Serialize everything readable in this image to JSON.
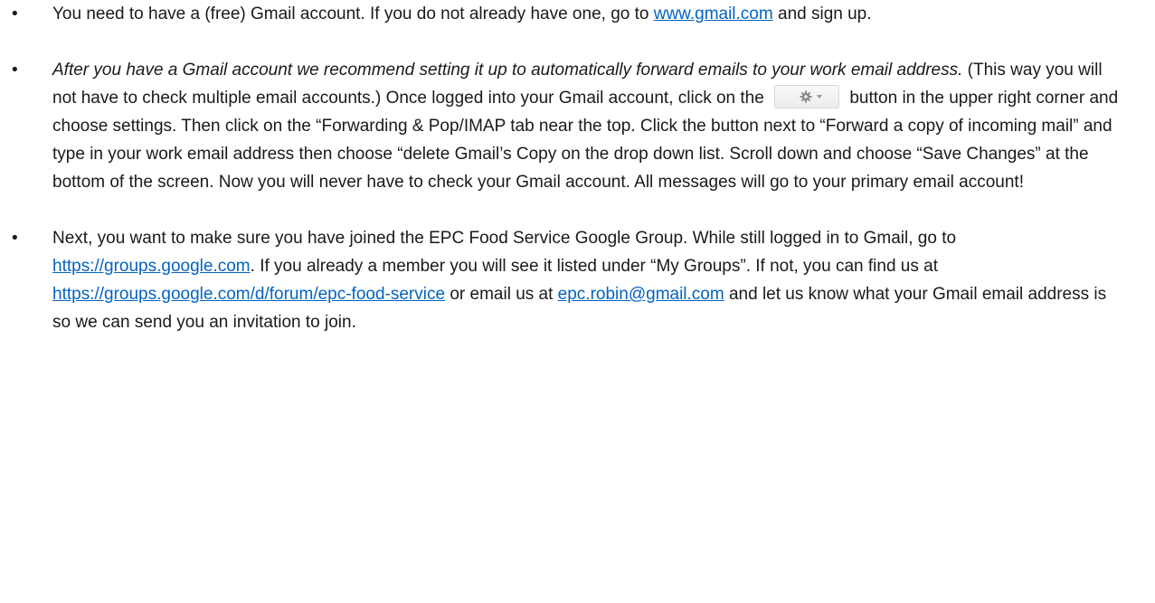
{
  "bullet_glyph": "•",
  "item1": {
    "t1": "You need to have a (free) Gmail account.  If you do not already have one, go to ",
    "link": "www.gmail.com",
    "t2": " and sign up."
  },
  "item2": {
    "italic": "After you have a Gmail account we recommend setting it up to automatically forward emails to your work email address.",
    "t1": "  (This way you will not have to check multiple email accounts.)  Once logged into your Gmail account, click on the ",
    "button_icon": "gear-icon",
    "t2": " button in the upper right corner and choose settings.  Then click on the “Forwarding & Pop/IMAP tab near the top.  Click the button next to “Forward a copy of incoming mail” and type in your work email address then choose “delete Gmail’s Copy on the drop down list.  Scroll down and choose “Save Changes” at the bottom of the screen.  Now you will never have to check your Gmail account.  All messages will go to your primary email account!"
  },
  "item3": {
    "t1": "Next, you want to make sure you have joined the EPC Food Service Google Group.  While still logged in to Gmail, go to ",
    "link1": "https://groups.google.com",
    "t2": ".  If you already a member you will see it listed under “My Groups”.  If not, you can find us at ",
    "link2": "https://groups.google.com/d/forum/epc-food-service",
    "t3": " or email us at ",
    "link3": "epc.robin@gmail.com",
    "t4": " and let us know what your Gmail email address is so we can send you an invitation to join."
  },
  "colors": {
    "link": "#0563c1",
    "text": "#1a1a1a"
  }
}
